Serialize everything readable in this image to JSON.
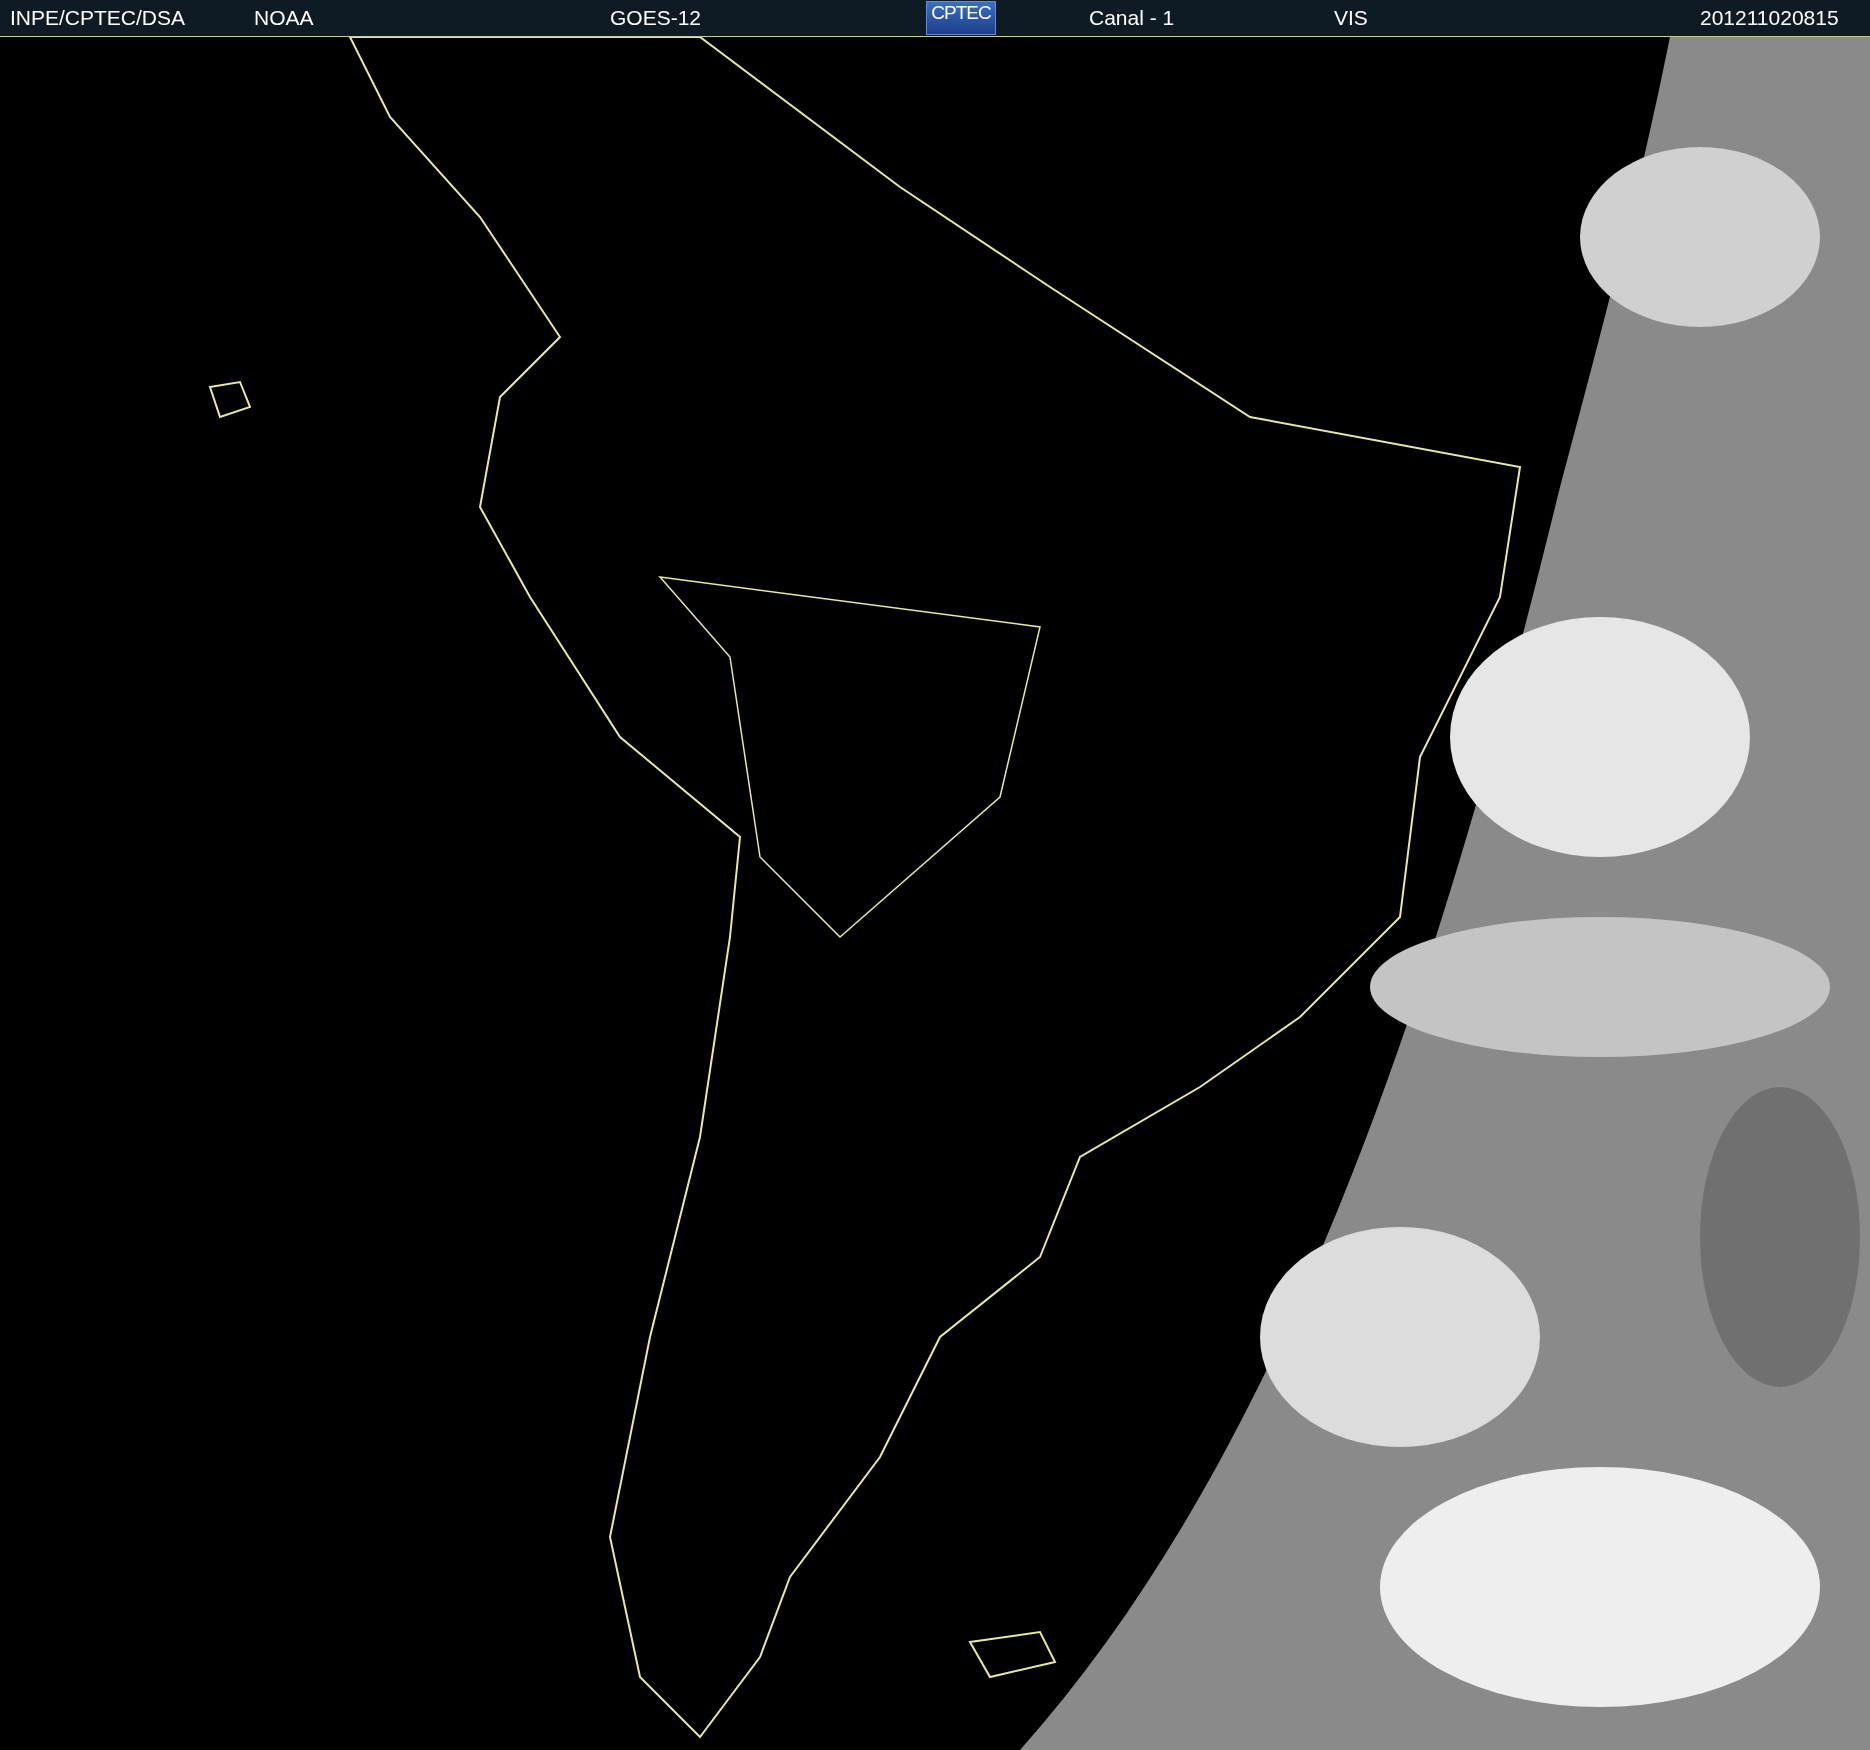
{
  "header": {
    "items": [
      {
        "kind": "text",
        "text": "INPE/CPTEC/DSA"
      },
      {
        "kind": "text",
        "text": "NOAA"
      },
      {
        "kind": "text",
        "text": "GOES-12"
      },
      {
        "kind": "logo",
        "text": "CPTEC"
      },
      {
        "kind": "text",
        "text": "Canal - 1"
      },
      {
        "kind": "text",
        "text": "VIS"
      },
      {
        "kind": "text",
        "text": "201211020815"
      }
    ]
  }
}
